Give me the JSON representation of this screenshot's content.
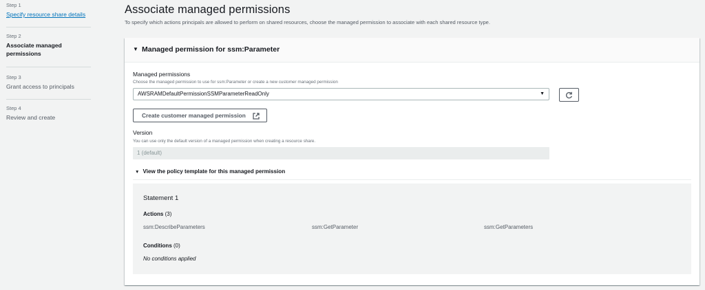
{
  "steps": [
    {
      "number": "Step 1",
      "title": "Specify resource share details"
    },
    {
      "number": "Step 2",
      "title_line1": "Associate managed",
      "title_line2": "permissions"
    },
    {
      "number": "Step 3",
      "title": "Grant access to principals"
    },
    {
      "number": "Step 4",
      "title": "Review and create"
    }
  ],
  "header": {
    "title": "Associate managed permissions",
    "description": "To specify which actions principals are allowed to perform on shared resources, choose the managed permission to associate with each shared resource type."
  },
  "panel": {
    "title": "Managed permission for ssm:Parameter",
    "managed_permissions": {
      "label": "Managed permissions",
      "help": "Choose the managed permission to use for ssm:Parameter or create a new customer managed permission",
      "selected": "AWSRAMDefaultPermissionSSMParameterReadOnly"
    },
    "create_button": "Create customer managed permission",
    "version": {
      "label": "Version",
      "help": "You can use only the default version of a managed permission when creating a resource share.",
      "value": "1 (default)"
    },
    "policy_toggle": "View the policy template for this managed permission",
    "statement": {
      "title": "Statement 1",
      "actions_label": "Actions",
      "actions_count": "(3)",
      "actions": [
        "ssm:DescribeParameters",
        "ssm:GetParameter",
        "ssm:GetParameters"
      ],
      "conditions_label": "Conditions",
      "conditions_count": "(0)",
      "conditions_empty": "No conditions applied"
    }
  },
  "colors": {
    "link": "#0073bb",
    "text": "#16191f",
    "muted": "#545b64",
    "background": "#f2f3f3"
  }
}
